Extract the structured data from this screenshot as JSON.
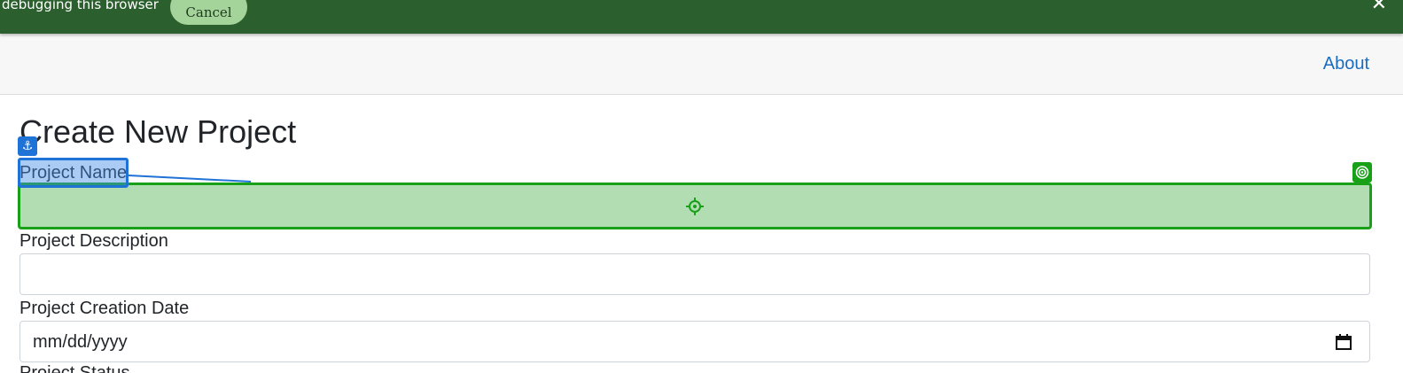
{
  "banner": {
    "text": "debugging this browser",
    "cancel_label": "Cancel",
    "close_label": "✕"
  },
  "navbar": {
    "about_label": "About"
  },
  "page": {
    "title": "Create New Project"
  },
  "form": {
    "project_name": {
      "label": "Project Name",
      "value": ""
    },
    "project_description": {
      "label": "Project Description",
      "value": ""
    },
    "project_creation_date": {
      "label": "Project Creation Date",
      "placeholder": "mm/dd/yyyy"
    },
    "next_field_label": "Project Status"
  },
  "overlay": {
    "anchor_glyph": "⚓",
    "colors": {
      "anchor": "#1f72d6",
      "target": "#18a018",
      "target_fill": "#b2dcb2"
    }
  },
  "icons": [
    "anchor-icon",
    "target-icon",
    "crosshair-icon",
    "calendar-icon",
    "close-icon"
  ],
  "colors": {
    "banner_bg": "#2b5f2d",
    "cancel_bg": "#a5d49a",
    "link": "#1a6cc1",
    "navbar_bg": "#f7f7f7"
  }
}
